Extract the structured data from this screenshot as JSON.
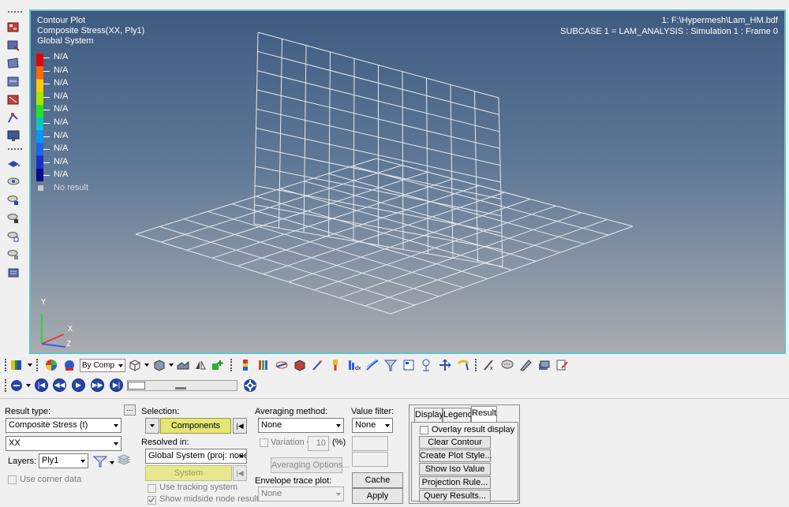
{
  "viewport": {
    "title_lines": [
      "Contour Plot",
      "Composite Stress(XX, Ply1)",
      "Global System"
    ],
    "info_lines": [
      "1: F:\\Hypermesh\\Lam_HM.bdf",
      "SUBCASE 1 = LAM_ANALYSIS  : Simulation 1 : Frame 0"
    ],
    "legend": {
      "labels": [
        "N/A",
        "N/A",
        "N/A",
        "N/A",
        "N/A",
        "N/A",
        "N/A",
        "N/A",
        "N/A",
        "N/A"
      ],
      "colors": [
        "#e60000",
        "#ff6a00",
        "#ffcc00",
        "#a8e600",
        "#1ee61e",
        "#00c8c8",
        "#0096ff",
        "#1e64e6",
        "#1432c8",
        "#0a0a8c"
      ],
      "no_result_label": "No result",
      "no_result_color": "#c8c8c8"
    },
    "triad": {
      "y": "Y",
      "x": "X",
      "z": "Z"
    }
  },
  "toolbar1": {
    "component_select": "By Comp"
  },
  "panel": {
    "result_type_label": "Result type:",
    "ellipsis_button": "...",
    "result_type_value": "Composite Stress (t)",
    "component_value": "XX",
    "layers_label": "Layers:",
    "layers_value": "Ply1",
    "use_corner_data": "Use corner data",
    "selection_label": "Selection:",
    "components_button": "Components",
    "resolved_in_label": "Resolved in:",
    "resolved_in_value": "Global System (proj: none)",
    "system_button": "System",
    "use_tracking_system": "Use tracking system",
    "show_midside": "Show midside node results",
    "averaging_method_label": "Averaging method:",
    "averaging_method_value": "None",
    "variation_label": "Variation <",
    "variation_value": "10",
    "variation_unit": "(%)",
    "averaging_options_button": "Averaging Options...",
    "envelope_label": "Envelope trace plot:",
    "envelope_value": "None",
    "value_filter_label": "Value filter:",
    "value_filter_value": "None",
    "cache_button": "Cache",
    "apply_button": "Apply",
    "tabs": [
      "Display",
      "Legend",
      "Result"
    ],
    "overlay_label": "Overlay result display",
    "result_buttons": [
      "Clear Contour",
      "Create Plot Style...",
      "Show Iso Value",
      "Projection Rule...",
      "Query Results..."
    ]
  }
}
